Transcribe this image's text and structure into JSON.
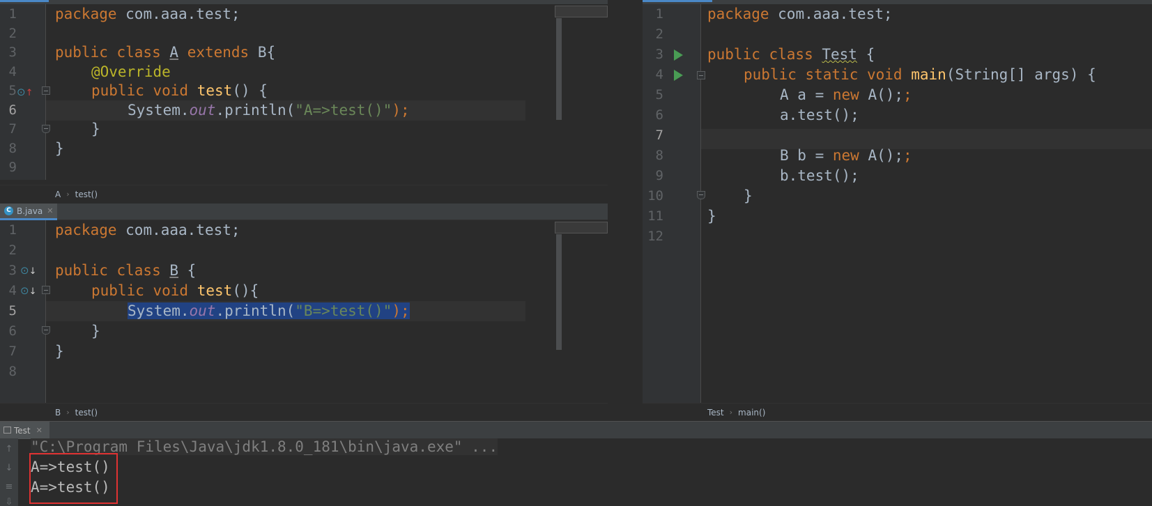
{
  "colors": {
    "keyword": "#cc7832",
    "annotation": "#bbb529",
    "function": "#ffc66d",
    "string": "#6a8759",
    "field": "#9876aa",
    "selection": "#214283",
    "highlight_box": "#e03232",
    "run": "#499c54"
  },
  "editor_a": {
    "line_numbers": [
      "1",
      "2",
      "3",
      "4",
      "5",
      "6",
      "7",
      "8",
      "9"
    ],
    "lines": [
      {
        "k": "package",
        "t": " com.aaa.test;"
      },
      {},
      {
        "k": "public class",
        "a": "A",
        "k2": "extends",
        "t": " B{"
      },
      {
        "ann": "@Override"
      },
      {
        "k": "public void",
        "f": "test",
        "t": "() {"
      },
      {
        "t1": "System.",
        "fld": "out",
        "t2": ".println(",
        "s": "\"A=>test()\"",
        "t3": ");"
      },
      {
        "t": "}"
      },
      {
        "t": "}"
      },
      {}
    ],
    "breadcrumb": [
      "A",
      "test()"
    ]
  },
  "editor_b": {
    "tab_label": "B.java",
    "tab_icon": "C",
    "line_numbers": [
      "1",
      "2",
      "3",
      "4",
      "5",
      "6",
      "7",
      "8"
    ],
    "lines": [
      {
        "k": "package",
        "t": " com.aaa.test;"
      },
      {},
      {
        "k": "public class",
        "a": "B",
        "t": " {"
      },
      {
        "k": "public void",
        "f": "test",
        "t": "(){"
      },
      {
        "t1": "System.",
        "fld": "out",
        "t2": ".println(",
        "s": "\"B=>test()\"",
        "t3": ");"
      },
      {
        "t": "}"
      },
      {
        "t": "}"
      },
      {}
    ],
    "breadcrumb": [
      "B",
      "test()"
    ]
  },
  "editor_test": {
    "line_numbers": [
      "1",
      "2",
      "3",
      "4",
      "5",
      "6",
      "7",
      "8",
      "9",
      "10",
      "11",
      "12"
    ],
    "lines": [
      {
        "k": "package",
        "t": " com.aaa.test;"
      },
      {},
      {
        "k": "public class",
        "a": "Test",
        "t": " {"
      },
      {
        "k": "public static void",
        "f": "main",
        "t": "(String[] args) {"
      },
      {
        "t1": "A a = ",
        "k": "new",
        "t2": " A();"
      },
      {
        "t": "a.test();"
      },
      {},
      {
        "t1": "B b = ",
        "k": "new",
        "t2": " A();"
      },
      {
        "t": "b.test();"
      },
      {
        "t": "}"
      },
      {
        "t": "}"
      },
      {}
    ],
    "breadcrumb": [
      "Test",
      "main()"
    ]
  },
  "console": {
    "tab_label": "Test",
    "command": "\"C:\\Program Files\\Java\\jdk1.8.0_181\\bin\\java.exe\" ...",
    "output": [
      "A=>test()",
      "A=>test()"
    ]
  }
}
